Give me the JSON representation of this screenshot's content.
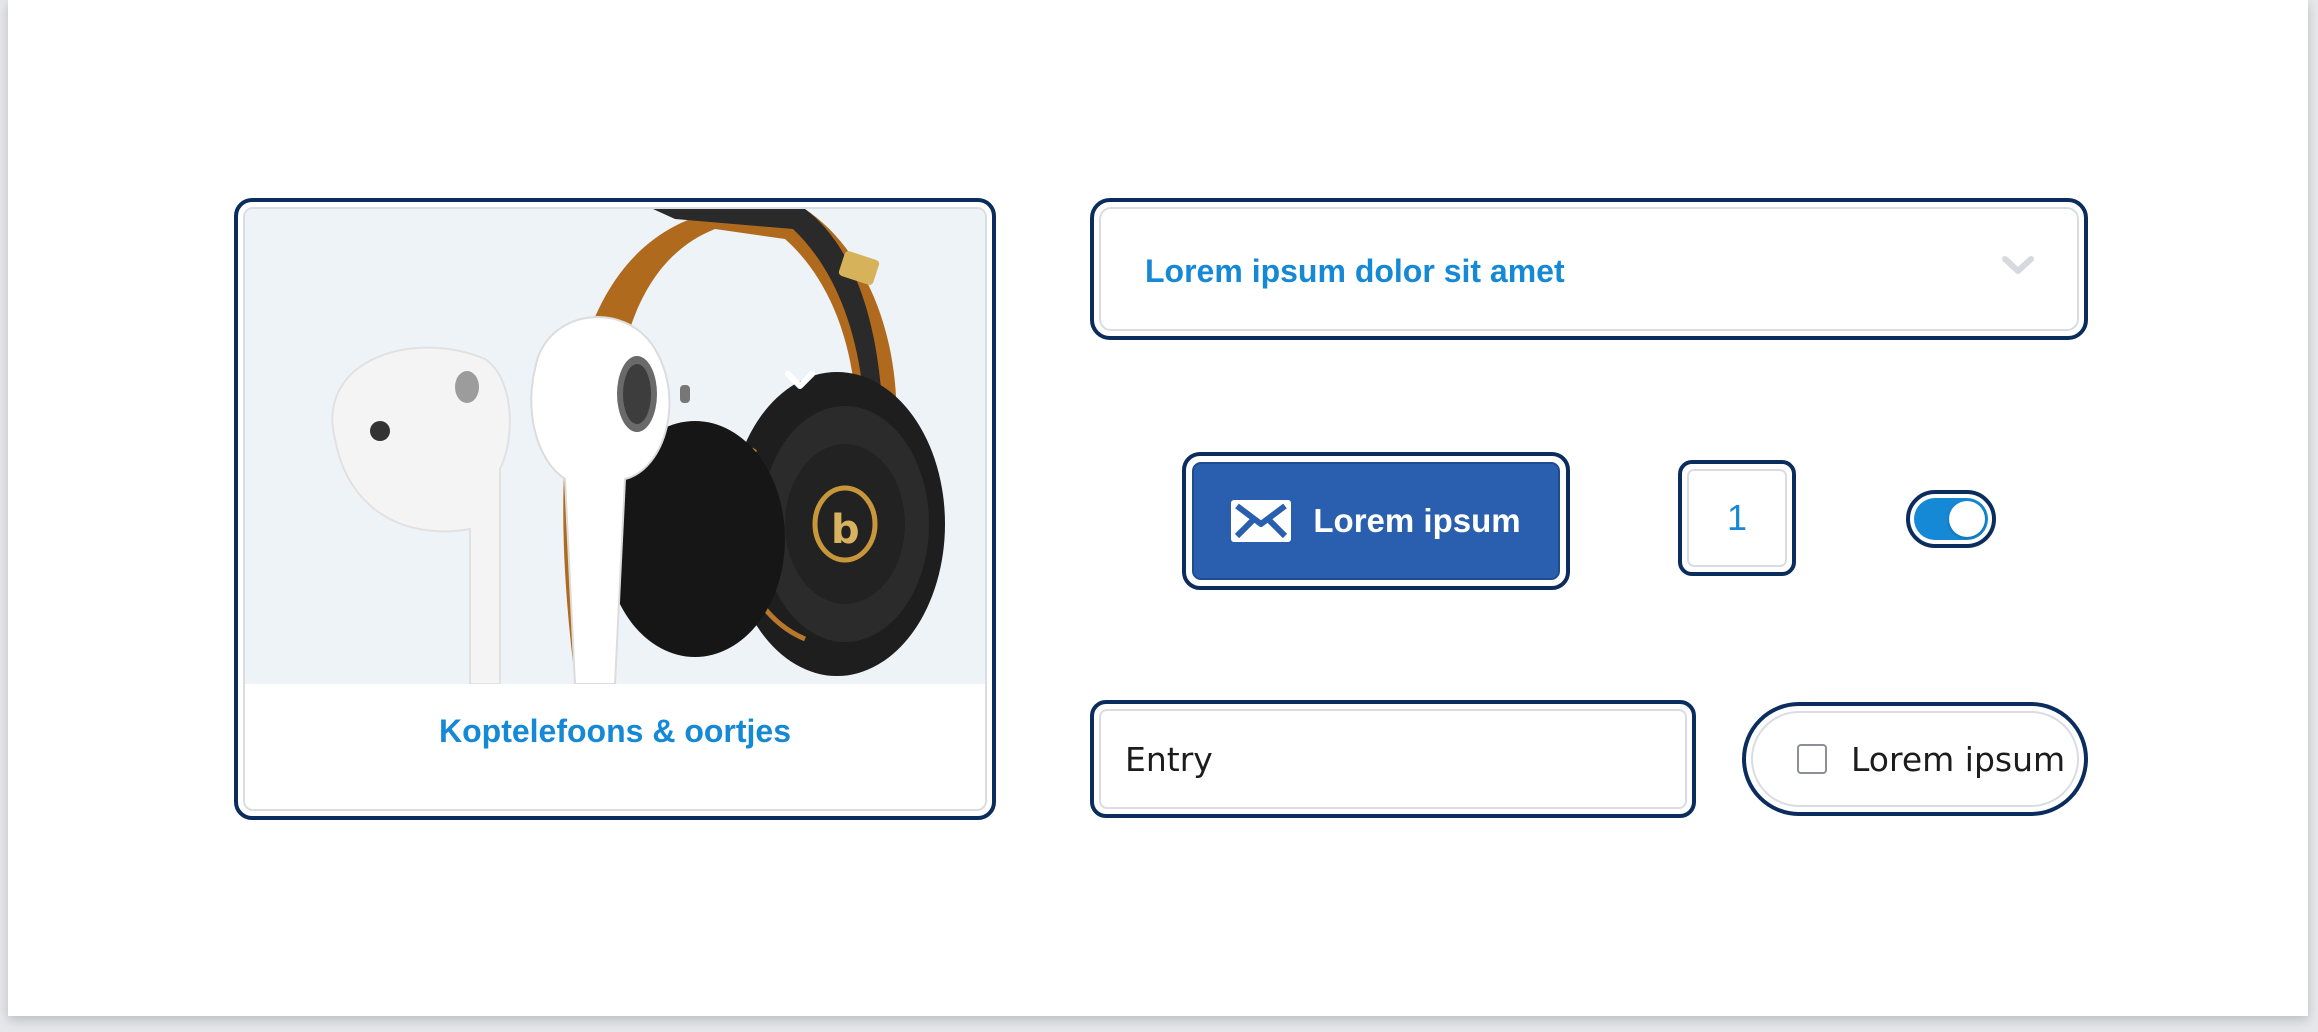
{
  "card": {
    "label": "Koptelefoons & oortjes",
    "image_alt": "headphones-and-earbuds-image"
  },
  "dropdown": {
    "selected": "Lorem ipsum dolor sit amet",
    "icon": "chevron-down-icon"
  },
  "button": {
    "label": "Lorem ipsum",
    "icon": "mail-icon"
  },
  "number_field": {
    "value": "1"
  },
  "toggle": {
    "on": true
  },
  "entry": {
    "value": "Entry"
  },
  "checkbox": {
    "label": "Lorem ipsum",
    "checked": false
  },
  "colors": {
    "focus_ring": "#0b2d5e",
    "accent": "#1589d6",
    "primary_button": "#2a5faf",
    "card_image_bg": "#eef3f8"
  }
}
